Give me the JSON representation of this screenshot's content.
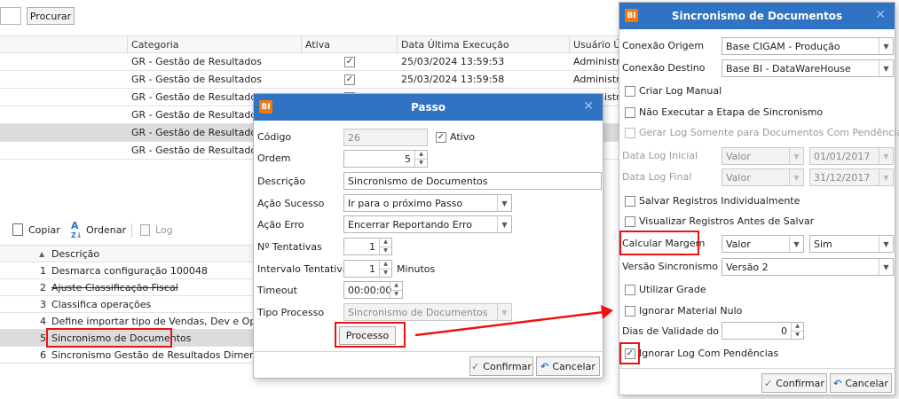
{
  "toolbar": {
    "search_label": "Procurar"
  },
  "grid_top": {
    "headers": {
      "categoria": "Categoria",
      "ativa": "Ativa",
      "data": "Data Última Execução",
      "usuario": "Usuário Últ"
    },
    "rows": [
      {
        "categoria": "GR - Gestão de Resultados",
        "ativa": true,
        "data": "25/03/2024 13:59:53",
        "usuario": "Administrad"
      },
      {
        "categoria": "GR - Gestão de Resultados",
        "ativa": true,
        "data": "25/03/2024 13:59:58",
        "usuario": "Administrad"
      },
      {
        "categoria": "GR - Gestão de Resultados",
        "ativa": true,
        "data": "",
        "usuario": "Administrad"
      },
      {
        "categoria": "GR - Gestão de Resultados",
        "ativa": false,
        "data": "",
        "usuario": ""
      },
      {
        "categoria": "GR - Gestão de Resultados",
        "ativa": false,
        "data": "",
        "usuario": ""
      },
      {
        "categoria": "GR - Gestão de Resultados",
        "ativa": false,
        "data": "",
        "usuario": ""
      }
    ]
  },
  "toolbar2": {
    "copiar": "Copiar",
    "ordenar": "Ordenar",
    "log": "Log"
  },
  "grid_bottom": {
    "header": "Descrição",
    "rows": [
      {
        "n": "1",
        "desc": "Desmarca configuração 100048"
      },
      {
        "n": "2",
        "desc": "Ajuste Classificação Fiscal"
      },
      {
        "n": "3",
        "desc": "Classifica operações"
      },
      {
        "n": "4",
        "desc": "Define importar tipo de Vendas, Dev e Operação"
      },
      {
        "n": "5",
        "desc": "Sincronismo de Documentos"
      },
      {
        "n": "6",
        "desc": "Sincronismo Gestão de Resultados Dimensões"
      }
    ]
  },
  "passo": {
    "icon": "BI",
    "title": "Passo",
    "codigo_label": "Código",
    "codigo_value": "26",
    "ativo_label": "Ativo",
    "ordem_label": "Ordem",
    "ordem_value": "5",
    "descricao_label": "Descrição",
    "descricao_value": "Sincronismo de Documentos",
    "acao_sucesso_label": "Ação Sucesso",
    "acao_sucesso_value": "Ir para o próximo Passo",
    "acao_erro_label": "Ação Erro",
    "acao_erro_value": "Encerrar Reportando Erro",
    "tentativas_label": "Nº Tentativas",
    "tentativas_value": "1",
    "intervalo_label": "Intervalo Tentativas",
    "intervalo_value": "1",
    "minutos_label": "Minutos",
    "timeout_label": "Timeout",
    "timeout_value": "00:00:00",
    "tipo_label": "Tipo Processo",
    "tipo_value": "Sincronismo de Documentos",
    "processo_button": "Processo",
    "confirmar": "Confirmar",
    "cancelar": "Cancelar"
  },
  "sync": {
    "icon": "BI",
    "title": "Sincronismo de Documentos",
    "origem_label": "Conexão Origem",
    "origem_value": "Base CIGAM - Produção",
    "destino_label": "Conexão Destino",
    "destino_value": "Base BI - DataWareHouse",
    "criar_log": "Criar Log Manual",
    "nao_executar": "Não Executar a Etapa de Sincronismo",
    "gerar_log": "Gerar Log Somente para Documentos Com Pendências",
    "data_log_inicial_label": "Data Log Inicial",
    "valor1": "Valor",
    "data_inicial": "01/01/2017",
    "data_log_final_label": "Data Log Final",
    "valor2": "Valor",
    "data_final": "31/12/2017",
    "salvar_registros": "Salvar Registros Individualmente",
    "visualizar_registros": "Visualizar Registros Antes de Salvar",
    "calcular_margem_label": "Calcular Margem",
    "margem_tipo": "Valor",
    "margem_value": "Sim",
    "versao_label": "Versão Sincronismo",
    "versao_value": "Versão 2",
    "utilizar_grade": "Utilizar Grade",
    "ignorar_material": "Ignorar Material Nulo",
    "dias_validade_label": "Dias de Validade do Log",
    "dias_validade_value": "0",
    "ignorar_log": "Ignorar Log Com Pendências",
    "confirmar": "Confirmar",
    "cancelar": "Cancelar"
  },
  "colors": {
    "title_bar": "#2f73c2",
    "highlight_red": "#e11111",
    "selected_row": "#dcdcdc"
  }
}
